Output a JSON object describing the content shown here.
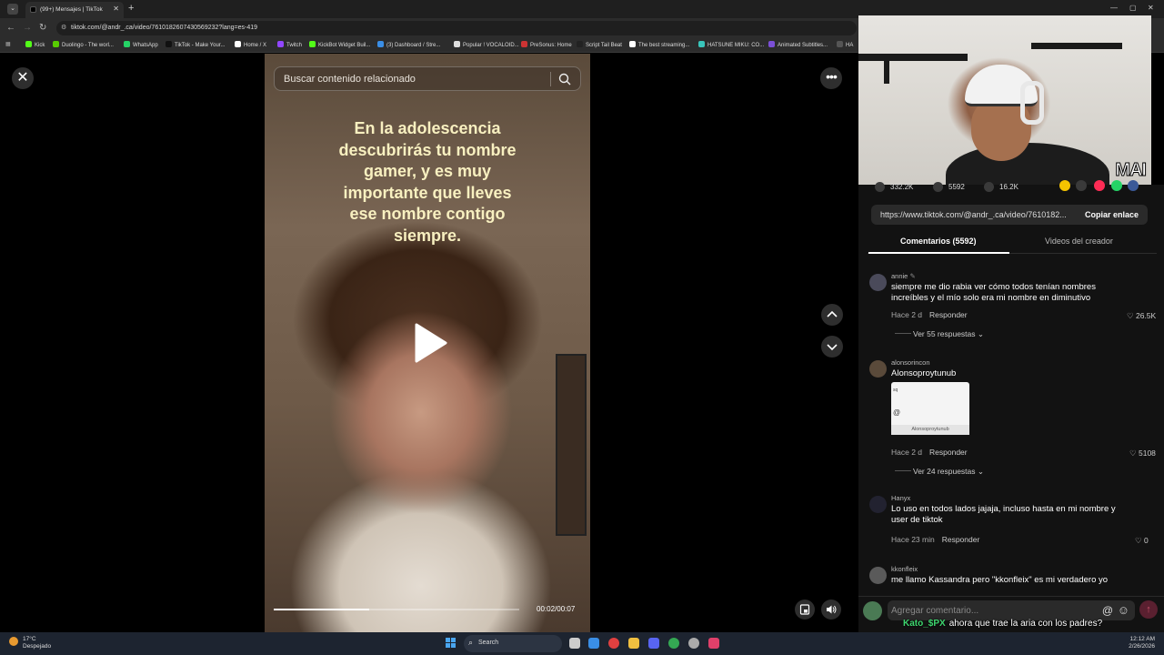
{
  "browser": {
    "tab_title": "(99+) Mensajes | TikTok",
    "url": "tiktok.com/@andr_.ca/video/7610182607430569232?lang=es-419",
    "bookmarks": [
      "Kick",
      "Duolingo - The worl...",
      "WhatsApp",
      "TikTok - Make Your...",
      "Home / X",
      "Twitch",
      "KickBot Widget Buil...",
      "(3) Dashboard / Stre...",
      "Popular ! VOCALOID...",
      "PreSonus: Home",
      "Script Tail Beat",
      "The best streaming...",
      "HATSUNE MIKU: CO...",
      "Animated Subtitles...",
      "HA"
    ],
    "bookmark_colors": [
      "#53fc18",
      "#58cc02",
      "#25d366",
      "#111111",
      "#ffffff",
      "#9146ff",
      "#53fc18",
      "#3a8ee6",
      "#dddddd",
      "#cc3333",
      "#222222",
      "#ffffff",
      "#39c5bb",
      "#7b4fd6",
      "#555555"
    ]
  },
  "video": {
    "search_placeholder": "Buscar contenido relacionado",
    "caption": "En la adolescencia descubrirás tu nombre gamer, y es muy importante que lleves ese nombre contigo siempre.",
    "time": "00:02/00:07",
    "progress": 0.39
  },
  "webcam": {
    "logo": "MAI"
  },
  "panel": {
    "likes": "332.2K",
    "comments_count": "5592",
    "saves": "16.2K",
    "share_colors": [
      "#f5c400",
      "#3a3a3a",
      "#fe2c55",
      "#25d366",
      "#3b5998"
    ],
    "link": "https://www.tiktok.com/@andr_.ca/video/7610182...",
    "copy_label": "Copiar enlace",
    "tab_comments": "Comentarios (5592)",
    "tab_creator": "Videos del creador",
    "comments": [
      {
        "user": "annie",
        "text": "siempre me dio rabia ver cómo todos tenían nombres increíbles y el mío solo era mi nombre en diminutivo",
        "time": "Hace 2 d",
        "reply": "Responder",
        "likes": "26.5K",
        "replies": "Ver 55 respuestas",
        "avatar": "#4a4a5a"
      },
      {
        "user": "alonsorincon",
        "text": "Alonsoproytunub",
        "time": "Hace 2 d",
        "reply": "Responder",
        "likes": "5108",
        "replies": "Ver 24 respuestas",
        "avatar": "#5a4a3a",
        "thumb_top": "sq",
        "thumb_mid": "@",
        "thumb_caption": "Alonsoproytunub"
      },
      {
        "user": "Hanyx",
        "text": "Lo uso en todos lados jajaja, incluso hasta en mi nombre y user de tiktok",
        "time": "Hace 23 min",
        "reply": "Responder",
        "likes": "0",
        "avatar": "#222230"
      },
      {
        "user": "kkonfleix",
        "text": "me llamo Kassandra pero \"kkonfleix\" es mi verdadero yo",
        "avatar": "#5a5a5a"
      }
    ],
    "composer_placeholder": "Agregar comentario...",
    "chat_user": "Kato_$PX",
    "chat_message": "ahora que trae la aria con los padres?"
  },
  "taskbar": {
    "temp": "17°C",
    "weather": "Despejado",
    "search": "Search",
    "time": "12:12 AM",
    "date": "2/26/2026"
  }
}
